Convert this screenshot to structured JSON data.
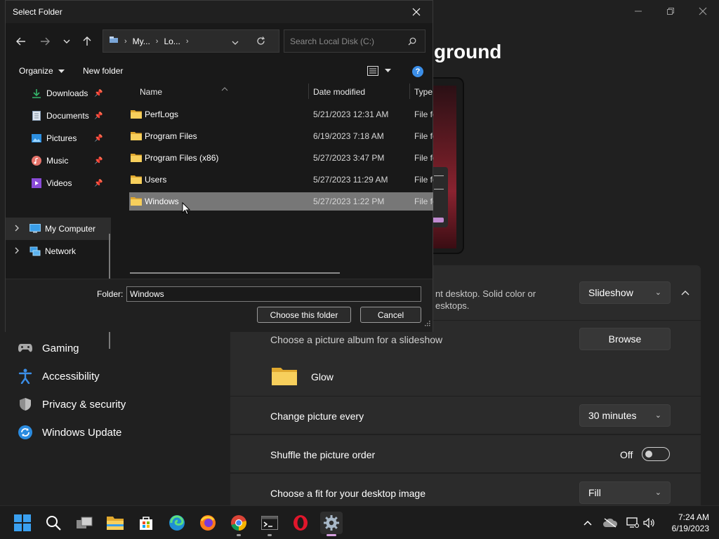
{
  "settings": {
    "page_title": "ground",
    "sidebar": [
      {
        "label": "Gaming",
        "icon": "gamepad-icon"
      },
      {
        "label": "Accessibility",
        "icon": "accessibility-icon"
      },
      {
        "label": "Privacy & security",
        "icon": "shield-icon"
      },
      {
        "label": "Windows Update",
        "icon": "update-icon"
      }
    ],
    "personalize_desc_line1": "nt desktop. Solid color or",
    "personalize_desc_line2": "esktops.",
    "background_type": "Slideshow",
    "album_label": "Choose a picture album for a slideshow",
    "browse_label": "Browse",
    "album_name": "Glow",
    "change_every_label": "Change picture every",
    "change_every_value": "30 minutes",
    "shuffle_label": "Shuffle the picture order",
    "shuffle_value": "Off",
    "fit_label": "Choose a fit for your desktop image",
    "fit_value": "Fill"
  },
  "dialog": {
    "title": "Select Folder",
    "address": {
      "seg1": "My...",
      "seg2": "Lo..."
    },
    "search_placeholder": "Search Local Disk (C:)",
    "organize_label": "Organize",
    "new_folder_label": "New folder",
    "help_glyph": "?",
    "nav_items": [
      {
        "label": "Downloads",
        "icon": "downloads-icon",
        "pinned": true
      },
      {
        "label": "Documents",
        "icon": "documents-icon",
        "pinned": true
      },
      {
        "label": "Pictures",
        "icon": "pictures-icon",
        "pinned": true
      },
      {
        "label": "Music",
        "icon": "music-icon",
        "pinned": true
      },
      {
        "label": "Videos",
        "icon": "videos-icon",
        "pinned": true
      },
      {
        "label": "My Computer",
        "icon": "computer-icon",
        "pinned": false
      },
      {
        "label": "Network",
        "icon": "network-icon",
        "pinned": false
      }
    ],
    "columns": {
      "name": "Name",
      "date": "Date modified",
      "type": "Type"
    },
    "files": [
      {
        "name": "PerfLogs",
        "date": "5/21/2023 12:31 AM",
        "type": "File fo"
      },
      {
        "name": "Program Files",
        "date": "6/19/2023 7:18 AM",
        "type": "File fo"
      },
      {
        "name": "Program Files (x86)",
        "date": "5/27/2023 3:47 PM",
        "type": "File fo"
      },
      {
        "name": "Users",
        "date": "5/27/2023 11:29 AM",
        "type": "File fo"
      },
      {
        "name": "Windows",
        "date": "5/27/2023 1:22 PM",
        "type": "File fo"
      }
    ],
    "selected_file": "Windows",
    "folder_label": "Folder:",
    "folder_value": "Windows",
    "choose_label": "Choose this folder",
    "cancel_label": "Cancel"
  },
  "taskbar": {
    "time": "7:24 AM",
    "date": "6/19/2023"
  },
  "colors": {
    "accent": "#3b8ee8",
    "folder": "#f5c44a",
    "selection": "#777777"
  }
}
